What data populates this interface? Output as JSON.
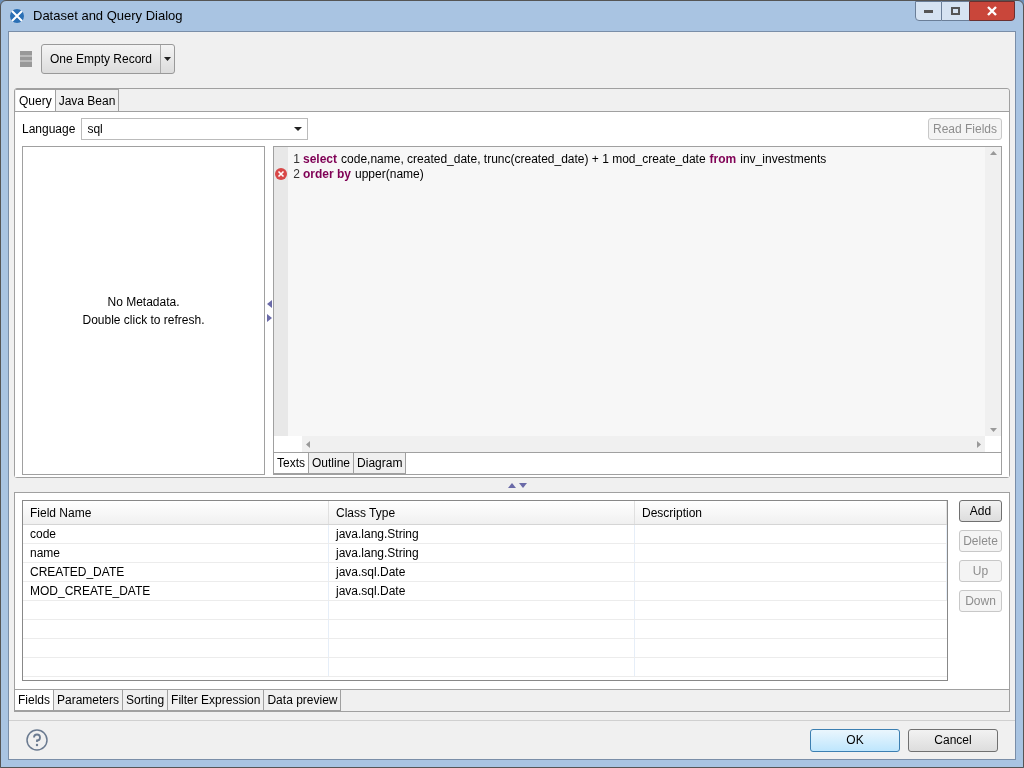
{
  "window": {
    "title": "Dataset and Query Dialog"
  },
  "toolbar": {
    "data_source": "One Empty Record"
  },
  "query_tabs": [
    {
      "label": "Query",
      "selected": true
    },
    {
      "label": "Java Bean",
      "selected": false
    }
  ],
  "language": {
    "label": "Language",
    "value": "sql"
  },
  "read_fields": {
    "label": "Read Fields",
    "disabled": true
  },
  "metadata": {
    "message": "No Metadata.",
    "hint": "Double click to refresh."
  },
  "editor": {
    "lines": [
      {
        "number": "1",
        "error": false,
        "tokens": [
          {
            "kind": "keyword",
            "text": "select"
          },
          {
            "kind": "plain",
            "text": "code,name, created_date, trunc(created_date) + 1 mod_create_date"
          },
          {
            "kind": "keyword",
            "text": "from"
          },
          {
            "kind": "plain",
            "text": "inv_investments"
          }
        ]
      },
      {
        "number": "2",
        "error": true,
        "tokens": [
          {
            "kind": "keyword",
            "text": "order by"
          },
          {
            "kind": "plain",
            "text": "upper(name)"
          }
        ]
      }
    ],
    "tabs": [
      {
        "label": "Texts",
        "selected": true
      },
      {
        "label": "Outline",
        "selected": false
      },
      {
        "label": "Diagram",
        "selected": false
      }
    ]
  },
  "fields_table": {
    "columns": [
      "Field Name",
      "Class Type",
      "Description"
    ],
    "rows": [
      [
        "code",
        "java.lang.String",
        ""
      ],
      [
        "name",
        "java.lang.String",
        ""
      ],
      [
        "CREATED_DATE",
        "java.sql.Date",
        ""
      ],
      [
        "MOD_CREATE_DATE",
        "java.sql.Date",
        ""
      ]
    ]
  },
  "side_buttons": [
    {
      "label": "Add",
      "disabled": false
    },
    {
      "label": "Delete",
      "disabled": true
    },
    {
      "label": "Up",
      "disabled": true
    },
    {
      "label": "Down",
      "disabled": true
    }
  ],
  "bottom_tabs": [
    {
      "label": "Fields",
      "selected": true
    },
    {
      "label": "Parameters",
      "selected": false
    },
    {
      "label": "Sorting",
      "selected": false
    },
    {
      "label": "Filter Expression",
      "selected": false
    },
    {
      "label": "Data preview",
      "selected": false
    }
  ],
  "buttons": [
    {
      "label": "OK",
      "default": true
    },
    {
      "label": "Cancel",
      "default": false
    }
  ]
}
